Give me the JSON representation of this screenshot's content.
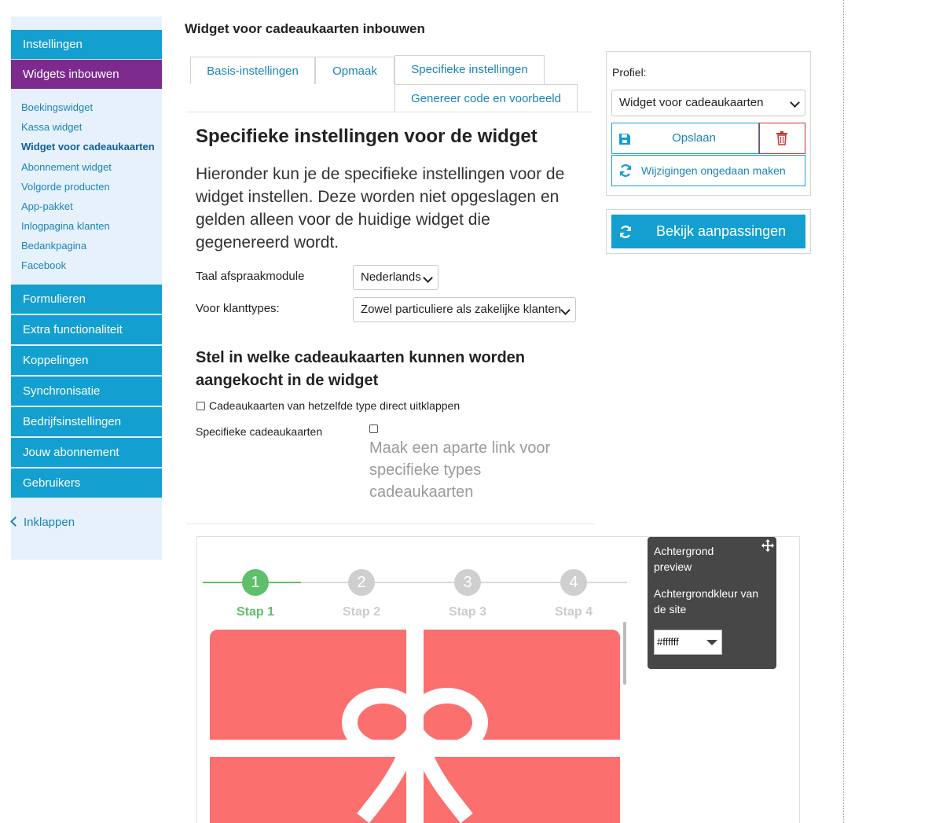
{
  "sidebar": {
    "top_sections": [
      {
        "label": "Instellingen",
        "active": false
      },
      {
        "label": "Widgets inbouwen",
        "active": true
      }
    ],
    "sub_items": [
      {
        "label": "Boekingswidget",
        "current": false
      },
      {
        "label": "Kassa widget",
        "current": false
      },
      {
        "label": "Widget voor cadeaukaarten",
        "current": true
      },
      {
        "label": "Abonnement widget",
        "current": false
      },
      {
        "label": "Volgorde producten",
        "current": false
      },
      {
        "label": "App-pakket",
        "current": false
      },
      {
        "label": "Inlogpagina klanten",
        "current": false
      },
      {
        "label": "Bedankpagina",
        "current": false
      },
      {
        "label": "Facebook",
        "current": false
      }
    ],
    "bottom_sections": [
      {
        "label": "Formulieren"
      },
      {
        "label": "Extra functionaliteit"
      },
      {
        "label": "Koppelingen"
      },
      {
        "label": "Synchronisatie"
      },
      {
        "label": "Bedrijfsinstellingen"
      },
      {
        "label": "Jouw abonnement"
      },
      {
        "label": "Gebruikers"
      }
    ],
    "collapse_label": "Inklappen"
  },
  "main": {
    "title": "Widget voor cadeaukaarten inbouwen",
    "tabs": [
      {
        "label": "Basis-instellingen"
      },
      {
        "label": "Opmaak"
      },
      {
        "label": "Specifieke instellingen",
        "active": true
      },
      {
        "label": "Genereer code en voorbeeld"
      }
    ],
    "section_title": "Specifieke instellingen voor de widget",
    "intro": "Hieronder kun je de specifieke instellingen voor de widget instellen. Deze worden niet opgeslagen en gelden alleen voor de huidige widget die gegenereerd wordt.",
    "language": {
      "label": "Taal afspraakmodule",
      "value": "Nederlands"
    },
    "customer_types": {
      "label": "Voor klanttypes:",
      "value": "Zowel particuliere als zakelijke klanten"
    },
    "giftcards_title": "Stel in welke cadeaukaarten kunnen worden aangekocht in de widget",
    "expand_checkbox": {
      "label": "Cadeaukaarten van hetzelfde type direct uitklappen",
      "checked": false
    },
    "specific": {
      "label": "Specifieke cadeaukaarten",
      "checked": false,
      "help": "Maak een aparte link voor specifieke types cadeaukaarten"
    }
  },
  "right_panel": {
    "profile_label": "Profiel:",
    "profile_value": "Widget voor cadeaukaarten",
    "save_label": "Opslaan",
    "undo_label": "Wijzigingen ongedaan maken",
    "view_changes_label": "Bekijk aanpassingen"
  },
  "preview": {
    "steps": [
      {
        "number": "1",
        "label": "Stap 1",
        "active": true
      },
      {
        "number": "2",
        "label": "Stap 2",
        "active": false
      },
      {
        "number": "3",
        "label": "Stap 3",
        "active": false
      },
      {
        "number": "4",
        "label": "Stap 4",
        "active": false
      }
    ],
    "colors": {
      "active_step": "#5fbf6a",
      "card": "#fb6f6f",
      "ribbon": "#ffffff"
    }
  },
  "float_panel": {
    "title": "Achtergrond preview",
    "bg_label": "Achtergrondkleur van de site",
    "bg_value": "#ffffff"
  },
  "colors": {
    "brand": "#139fcf",
    "active_nav": "#7d2a8f",
    "link": "#1b84b7"
  }
}
